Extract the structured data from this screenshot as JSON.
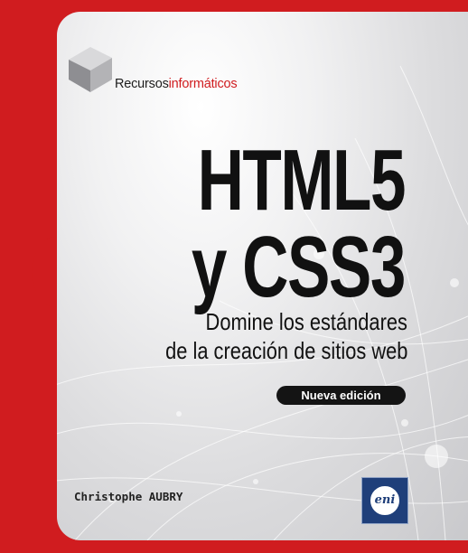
{
  "publisher": {
    "series_part1": "Recursos",
    "series_part2": "informáticos",
    "logo_text": "eni"
  },
  "book": {
    "title_line1": "HTML5",
    "title_line2": "y CSS3",
    "subtitle_line1": "Domine los estándares",
    "subtitle_line2": "de la creación de sitios web",
    "edition_badge": "Nueva edición",
    "author": "Christophe AUBRY"
  },
  "colors": {
    "brand_red": "#d01c1f",
    "title_black": "#111111",
    "logo_blue": "#1f3f7a"
  },
  "icons": {
    "series_icon": "cube-icon",
    "publisher_icon": "eni-logo"
  }
}
